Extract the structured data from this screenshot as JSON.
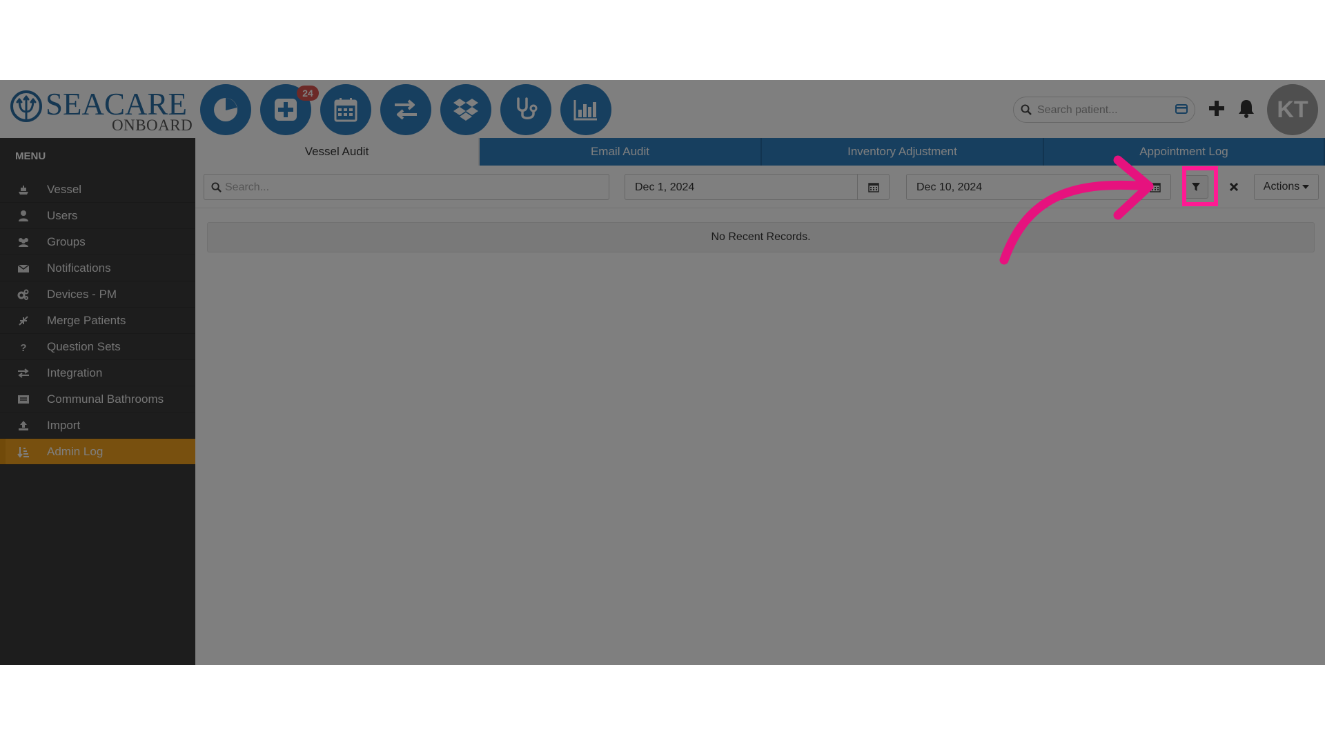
{
  "app": {
    "brand_main": "SEACARE",
    "brand_sub": "ONBOARD"
  },
  "topnav": {
    "icons": [
      {
        "name": "dashboard-icon"
      },
      {
        "name": "medical-add-icon"
      },
      {
        "name": "calendar-icon"
      },
      {
        "name": "transfer-icon"
      },
      {
        "name": "dropbox-icon"
      },
      {
        "name": "stethoscope-icon"
      },
      {
        "name": "bar-chart-icon"
      }
    ],
    "badge_count": "24",
    "search_placeholder": "Search patient...",
    "avatar_initials": "KT"
  },
  "sidebar": {
    "title": "MENU",
    "items": [
      {
        "label": "Vessel",
        "icon": "ship-icon"
      },
      {
        "label": "Users",
        "icon": "user-icon"
      },
      {
        "label": "Groups",
        "icon": "group-icon"
      },
      {
        "label": "Notifications",
        "icon": "envelope-icon"
      },
      {
        "label": "Devices - PM",
        "icon": "cogs-icon"
      },
      {
        "label": "Merge Patients",
        "icon": "merge-icon"
      },
      {
        "label": "Question Sets",
        "icon": "question-icon"
      },
      {
        "label": "Integration",
        "icon": "exchange-icon"
      },
      {
        "label": "Communal Bathrooms",
        "icon": "list-alt-icon"
      },
      {
        "label": "Import",
        "icon": "upload-icon"
      },
      {
        "label": "Admin Log",
        "icon": "sort-icon",
        "active": true
      }
    ]
  },
  "tabs": [
    {
      "label": "Vessel Audit",
      "active": true
    },
    {
      "label": "Email Audit"
    },
    {
      "label": "Inventory Adjustment"
    },
    {
      "label": "Appointment Log"
    }
  ],
  "filters": {
    "search_placeholder": "Search...",
    "date_from": "Dec 1, 2024",
    "date_to": "Dec 10, 2024",
    "actions_label": "Actions"
  },
  "records": {
    "empty_message": "No Recent Records."
  },
  "colors": {
    "primary": "#2f7fbf",
    "active": "#f0a01e",
    "sidebar": "#3a3a3a",
    "highlight": "#ff3ea5",
    "badge": "#d9534f"
  }
}
